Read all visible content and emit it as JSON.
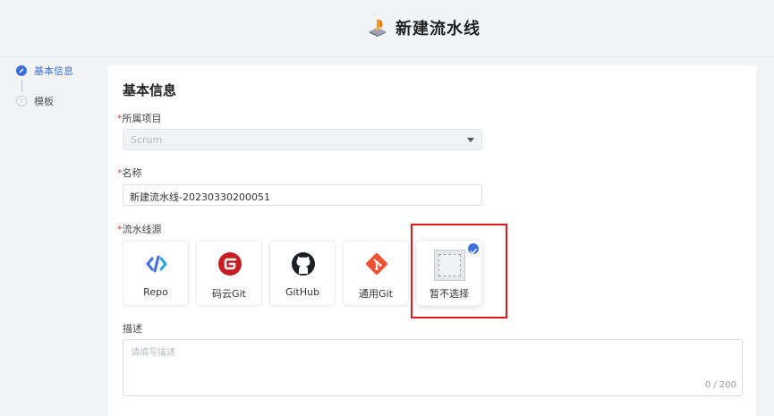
{
  "header": {
    "title": "新建流水线",
    "icon": "pipeline-logo-icon"
  },
  "steps": [
    {
      "label": "基本信息",
      "state": "active"
    },
    {
      "label": "模板",
      "state": "inactive"
    }
  ],
  "form": {
    "section_title": "基本信息",
    "required_mark": "*",
    "project": {
      "label": "所属项目",
      "value": "Scrum",
      "disabled": true
    },
    "name": {
      "label": "名称",
      "value": "新建流水线-20230330200051"
    },
    "source": {
      "label": "流水线源",
      "options": [
        {
          "name": "Repo",
          "icon": "repo-icon",
          "color": "#3f6fd8"
        },
        {
          "name": "码云Git",
          "icon": "gitee-icon",
          "color": "#c71d23"
        },
        {
          "name": "GitHub",
          "icon": "github-icon",
          "color": "#1b1f23"
        },
        {
          "name": "通用Git",
          "icon": "git-icon",
          "color": "#f05133"
        },
        {
          "name": "暂不选择",
          "icon": "none-placeholder-icon",
          "selected": true
        }
      ]
    },
    "description": {
      "label": "描述",
      "placeholder": "请填写描述",
      "count": "0 / 200"
    }
  },
  "colors": {
    "accent": "#3f6fd8",
    "highlight_border": "#e0191d",
    "required": "#e23b3b"
  }
}
